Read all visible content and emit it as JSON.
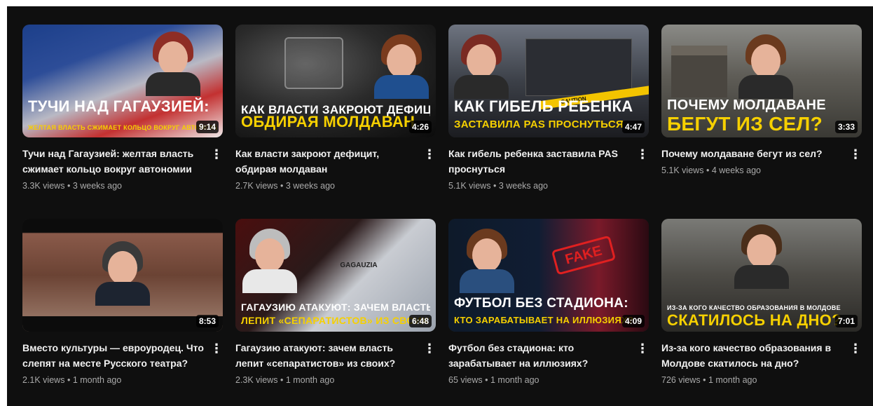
{
  "videos": [
    {
      "title": "Тучи над Гагаузией: желтая власть сжимает кольцо вокруг автономии",
      "views": "3.3K views",
      "age": "3 weeks ago",
      "duration": "9:14",
      "thumb_line1": "ТУЧИ НАД ГАГАУЗИЕЙ:",
      "thumb_line2": "ЖЕЛТАЯ ВЛАСТЬ СЖИМАЕТ КОЛЬЦО ВОКРУГ АВТОНОМИИ"
    },
    {
      "title": "Как власти закроют дефицит, обдирая молдаван",
      "views": "2.7K views",
      "age": "3 weeks ago",
      "duration": "4:26",
      "thumb_line1": "КАК ВЛАСТИ ЗАКРОЮТ ДЕФИЦИТ,",
      "thumb_line2": "ОБДИРАЯ МОЛДАВАН"
    },
    {
      "title": "Как гибель ребенка заставила PAS проснуться",
      "views": "5.1K views",
      "age": "3 weeks ago",
      "duration": "4:47",
      "thumb_line1": "КАК ГИБЕЛЬ РЕБЕНКА",
      "thumb_line2": "ЗАСТАВИЛА PAS ПРОСНУТЬСЯ"
    },
    {
      "title": "Почему молдаване бегут из сел?",
      "views": "5.1K views",
      "age": "4 weeks ago",
      "duration": "3:33",
      "thumb_line1": "ПОЧЕМУ МОЛДАВАНЕ",
      "thumb_line2": "БЕГУТ ИЗ СЕЛ?"
    },
    {
      "title": "Вместо культуры — евроуродец. Что слепят на месте Русского театра?",
      "views": "2.1K views",
      "age": "1 month ago",
      "duration": "8:53",
      "thumb_line1": "",
      "thumb_line2": ""
    },
    {
      "title": "Гагаузию атакуют: зачем власть лепит «сепаратистов» из своих?",
      "views": "2.3K views",
      "age": "1 month ago",
      "duration": "6:48",
      "thumb_line1": "ГАГАУЗИЮ АТАКУЮТ: ЗАЧЕМ ВЛАСТЬ",
      "thumb_line2": "ЛЕПИТ «СЕПАРАТИСТОВ» ИЗ СВОИХ?"
    },
    {
      "title": "Футбол без стадиона: кто зарабатывает на иллюзиях?",
      "views": "65 views",
      "age": "1 month ago",
      "duration": "4:09",
      "thumb_line1": "ФУТБОЛ БЕЗ СТАДИОНА:",
      "thumb_line2": "КТО ЗАРАБАТЫВАЕТ НА ИЛЛЮЗИЯХ?"
    },
    {
      "title": "Из-за кого качество образования в Молдове скатилось на дно?",
      "views": "726 views",
      "age": "1 month ago",
      "duration": "7:01",
      "thumb_line1": "ИЗ-ЗА КОГО КАЧЕСТВО ОБРАЗОВАНИЯ В МОЛДОВЕ",
      "thumb_line2": "СКАТИЛОСЬ НА ДНО?"
    }
  ],
  "thumb_extras": {
    "gagauzia_map_label": "GAGAUZIA",
    "fake_stamp": "FAKE",
    "caution_tape": "CAUTION"
  },
  "separator": "•",
  "menu_icon": "vertical-dots-icon",
  "colors": {
    "background": "#0f0f0f",
    "title": "#f1f1f1",
    "meta": "#aaaaaa",
    "caption_yellow": "#f6d000"
  }
}
